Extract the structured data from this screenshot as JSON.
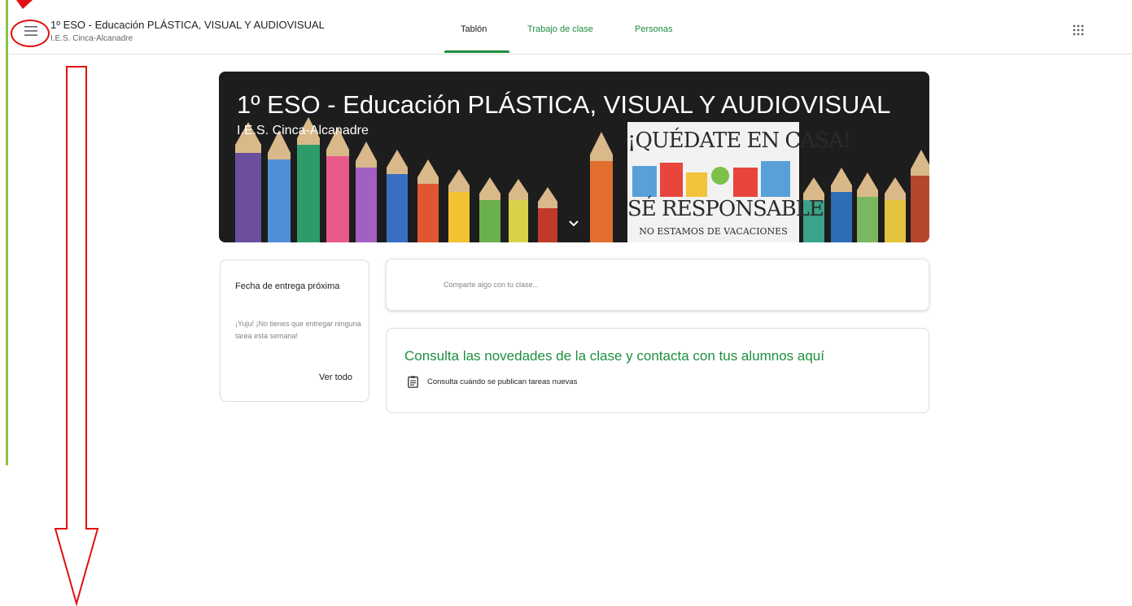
{
  "colors": {
    "accent_green": "#1e8e3e",
    "left_bar": "#8bc34a",
    "annotation_red": "#e01010"
  },
  "header": {
    "menu_icon": "hamburger-menu-icon",
    "class_title": "1º ESO - Educación PLÁSTICA, VISUAL Y AUDIOVISUAL",
    "class_subtitle": "I.E.S. Cinca-Alcanadre",
    "apps_icon": "google-apps-grid-icon"
  },
  "tabs": [
    {
      "label": "Tablón",
      "active": true
    },
    {
      "label": "Trabajo de clase",
      "active": false
    },
    {
      "label": "Personas",
      "active": false
    }
  ],
  "banner": {
    "title": "1º ESO - Educación PLÁSTICA, VISUAL Y AUDIOVISUAL",
    "subtitle": "I.E.S. Cinca-Alcanadre",
    "poster_line1": "¡QUÉDATE EN CASA!",
    "poster_line2": "SÉ RESPONSABLE",
    "poster_line3": "NO ESTAMOS DE VACACIONES",
    "expand_icon": "chevron-down-icon"
  },
  "upcoming": {
    "title": "Fecha de entrega próxima",
    "text": "¡Yuju! ¡No tienes que entregar ninguna tarea esta semana!",
    "link": "Ver todo"
  },
  "share": {
    "placeholder": "Comparte algo con tu clase..."
  },
  "info_card": {
    "title": "Consulta las novedades de la clase y contacta con tus alumnos aquí",
    "item_icon": "assignment-icon",
    "item_text": "Consulta cuándo se publican tareas nuevas"
  }
}
